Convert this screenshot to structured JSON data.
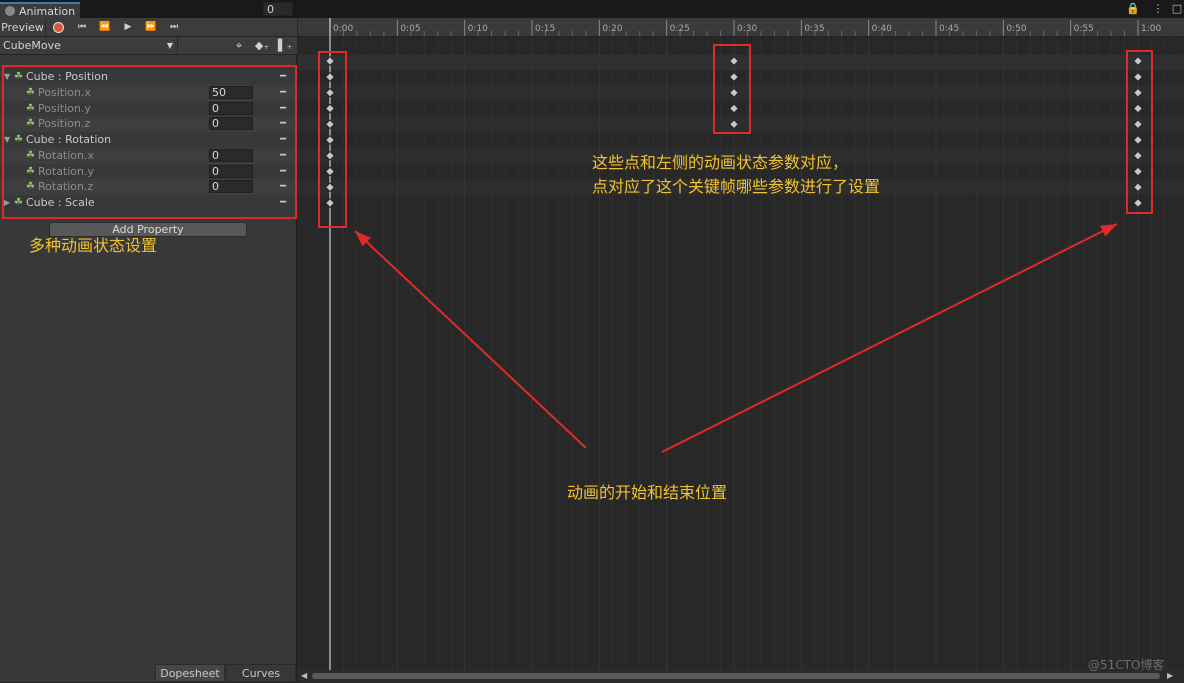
{
  "window": {
    "tab_label": "Animation",
    "lock_icon": "lock-icon",
    "menu_icon": "kebab-menu-icon"
  },
  "toolbar": {
    "preview_label": "Preview",
    "frame_value": "0",
    "clip_name": "CubeMove",
    "colors": {
      "record": "#d8573c",
      "accent": "#3a79bb"
    }
  },
  "properties": {
    "rows": [
      {
        "label": "Cube : Position",
        "level": 0,
        "fold": "▼",
        "value": ""
      },
      {
        "label": "Position.x",
        "level": 1,
        "fold": "",
        "value": "50"
      },
      {
        "label": "Position.y",
        "level": 1,
        "fold": "",
        "value": "0"
      },
      {
        "label": "Position.z",
        "level": 1,
        "fold": "",
        "value": "0"
      },
      {
        "label": "Cube : Rotation",
        "level": 0,
        "fold": "▼",
        "value": ""
      },
      {
        "label": "Rotation.x",
        "level": 1,
        "fold": "",
        "value": "0"
      },
      {
        "label": "Rotation.y",
        "level": 1,
        "fold": "",
        "value": "0"
      },
      {
        "label": "Rotation.z",
        "level": 1,
        "fold": "",
        "value": "0"
      },
      {
        "label": "Cube : Scale",
        "level": 0,
        "fold": "▶",
        "value": ""
      }
    ],
    "add_property_label": "Add Property"
  },
  "bottom_tabs": {
    "dopesheet": "Dopesheet",
    "curves": "Curves"
  },
  "timeline": {
    "ticks": [
      "0:00",
      "0:05",
      "0:10",
      "0:15",
      "0:20",
      "0:25",
      "0:30",
      "0:35",
      "0:40",
      "0:45",
      "0:50",
      "0:55",
      "1:00"
    ],
    "keyframe_times": [
      "0:00",
      "0:30",
      "1:00"
    ],
    "keyframe_rows_at_0_00": 10,
    "keyframe_rows_at_0_30": 5,
    "keyframe_rows_at_1_00": 10
  },
  "annotations": {
    "left_label": "多种动画状态设置",
    "keyframe_note_line1": "这些点和左侧的动画状态参数对应，",
    "keyframe_note_line2": "点对应了这个关键帧哪些参数进行了设置",
    "start_end_label": "动画的开始和结束位置",
    "color": "#f1c232",
    "box_color": "#e02a2a"
  },
  "watermark": "@51CTO博客"
}
